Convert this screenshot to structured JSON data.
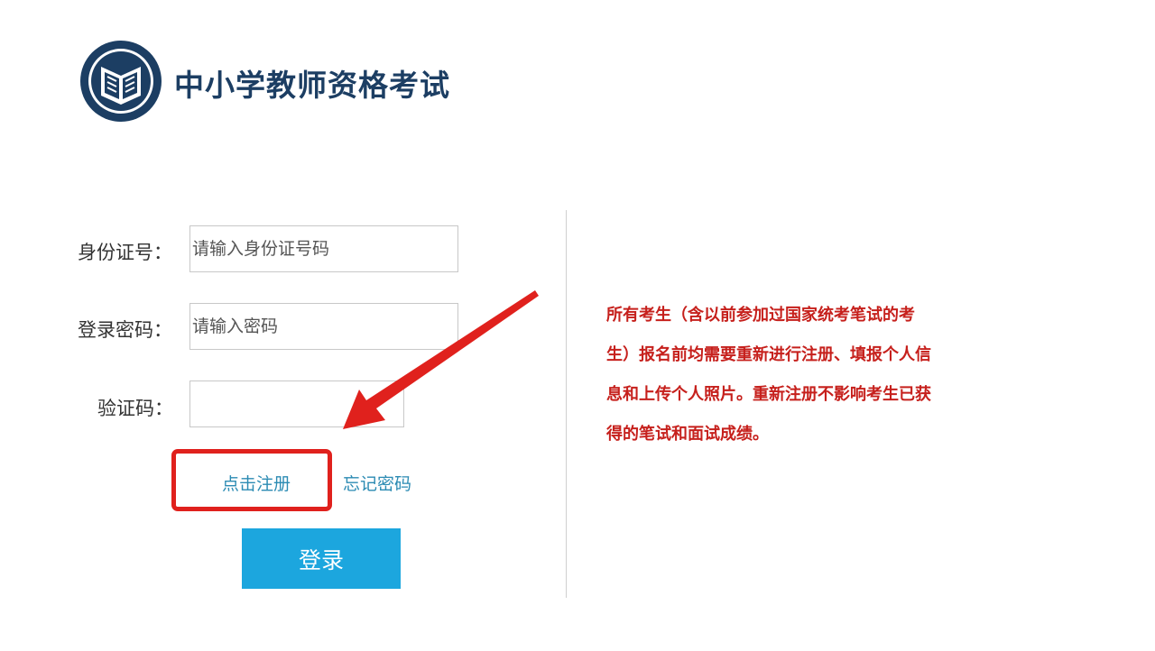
{
  "header": {
    "title": "中小学教师资格考试"
  },
  "form": {
    "id_label": "身份证号：",
    "id_placeholder": "请输入身份证号码",
    "password_label": "登录密码：",
    "password_placeholder": "请输入密码",
    "captcha_label": "验证码：",
    "captcha_value": ""
  },
  "links": {
    "register": "点击注册",
    "forgot_password": "忘记密码"
  },
  "login_button": "登录",
  "notice": {
    "lines": [
      "所有考生（含以前参加过国家统考笔试的考",
      "生）报名前均需要重新进行注册、填报个人信",
      "息和上传个人照片。重新注册不影响考生已获",
      "得的笔试和面试成绩。"
    ]
  },
  "colors": {
    "title": "#1c3e63",
    "link": "#2b8bb3",
    "button": "#1ca6de",
    "notice": "#c6201c",
    "annotation": "#e0211d"
  }
}
